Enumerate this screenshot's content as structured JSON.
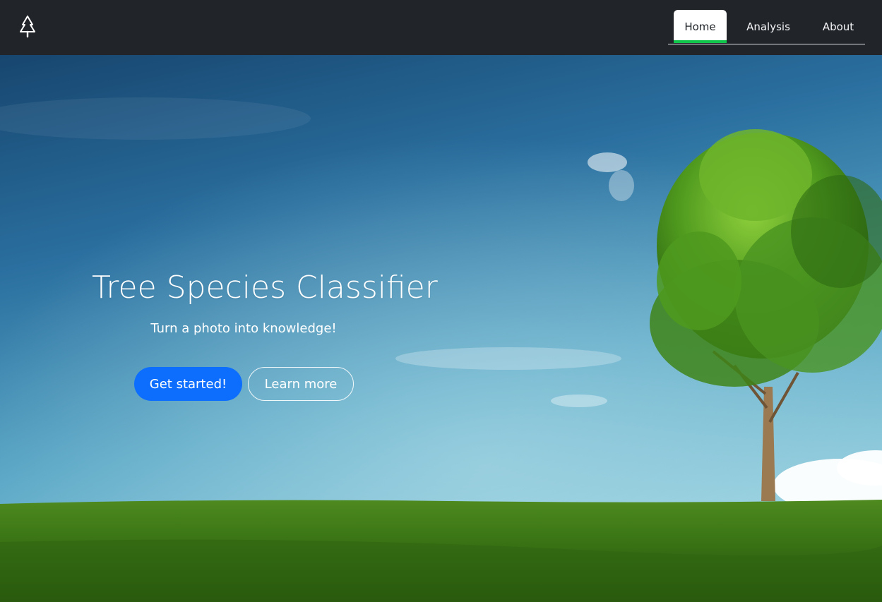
{
  "nav": {
    "logo_icon": "tree-icon",
    "items": [
      {
        "label": "Home",
        "active": true
      },
      {
        "label": "Analysis",
        "active": false
      },
      {
        "label": "About",
        "active": false
      }
    ],
    "active_underline_color": "#10c64a"
  },
  "hero": {
    "title": "Tree Species Classifier",
    "subtitle": "Turn a photo into knowledge!",
    "primary_button": "Get started!",
    "secondary_button": "Learn more",
    "primary_color": "#0d6efd"
  }
}
